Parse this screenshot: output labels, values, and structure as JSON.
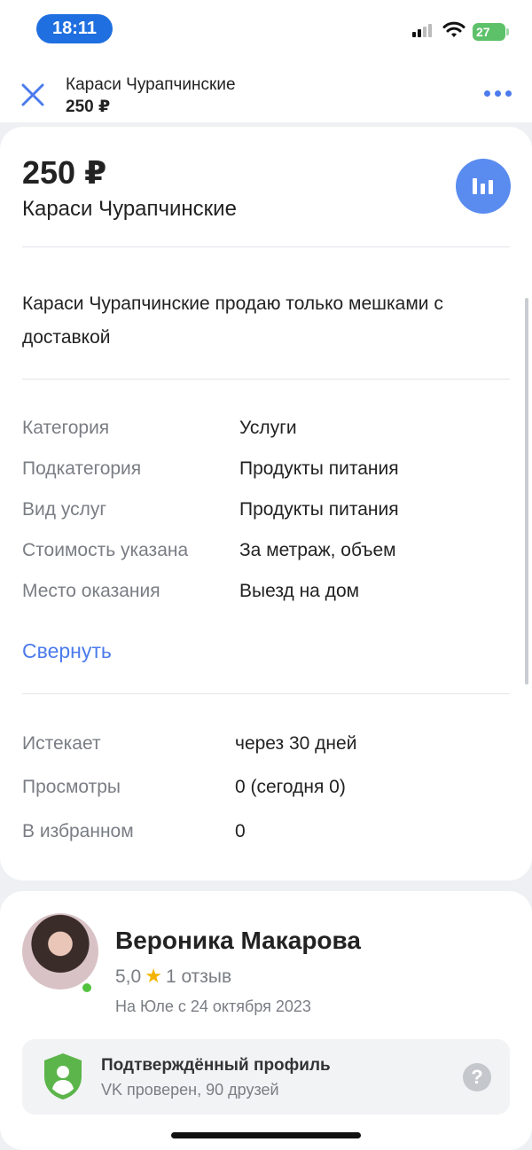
{
  "status_bar": {
    "time": "18:11",
    "battery": "27"
  },
  "header": {
    "title": "Караси Чурапчинские",
    "price": "250 ₽"
  },
  "listing": {
    "price": "250 ₽",
    "title": "Караси Чурапчинские",
    "description": "Караси Чурапчинские продаю только мешками с доставкой",
    "attributes": [
      {
        "label": "Категория",
        "value": "Услуги"
      },
      {
        "label": "Подкатегория",
        "value": "Продукты питания"
      },
      {
        "label": "Вид услуг",
        "value": "Продукты питания"
      },
      {
        "label": "Стоимость указана",
        "value": "За метраж, объем"
      },
      {
        "label": "Место оказания",
        "value": "Выезд на дом"
      }
    ],
    "collapse_label": "Свернуть",
    "meta": [
      {
        "label": "Истекает",
        "value": "через 30 дней"
      },
      {
        "label": "Просмотры",
        "value": "0 (сегодня 0)"
      },
      {
        "label": "В избранном",
        "value": "0"
      }
    ]
  },
  "seller": {
    "name": "Вероника Макарова",
    "rating": "5,0",
    "reviews": "1 отзыв",
    "since": "На Юле с 24 октября 2023",
    "verified_title": "Подтверждённый профиль",
    "verified_subtitle": "VK проверен, 90 друзей"
  },
  "colors": {
    "accent": "#4b7bec",
    "stats_button": "#5a8cf0",
    "online": "#52c23e",
    "shield": "#5bb54a",
    "star": "#f5b300"
  }
}
